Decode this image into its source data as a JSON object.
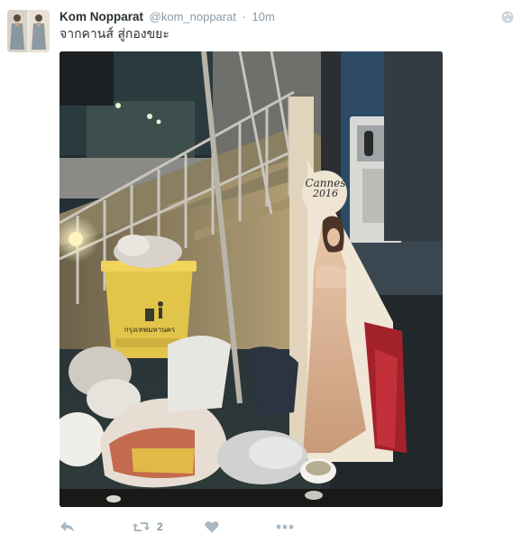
{
  "tweet": {
    "full_name": "Kom Nopparat",
    "username": "@kom_nopparat",
    "separator": "·",
    "time": "10m",
    "text": "จากคานส์ สู่กองขยะ",
    "actions": {
      "reply_icon": "reply-icon",
      "retweet_icon": "retweet-icon",
      "retweet_count": "2",
      "like_icon": "heart-icon",
      "more_icon": "more-dots-icon"
    }
  },
  "photo": {
    "standee_logo_text": "Cannes",
    "standee_logo_year": "2016",
    "bin_label": "กรุงเทพมหานคร"
  },
  "colors": {
    "name": "#292f33",
    "meta": "#8899a6",
    "icon": "#aab8c2"
  }
}
